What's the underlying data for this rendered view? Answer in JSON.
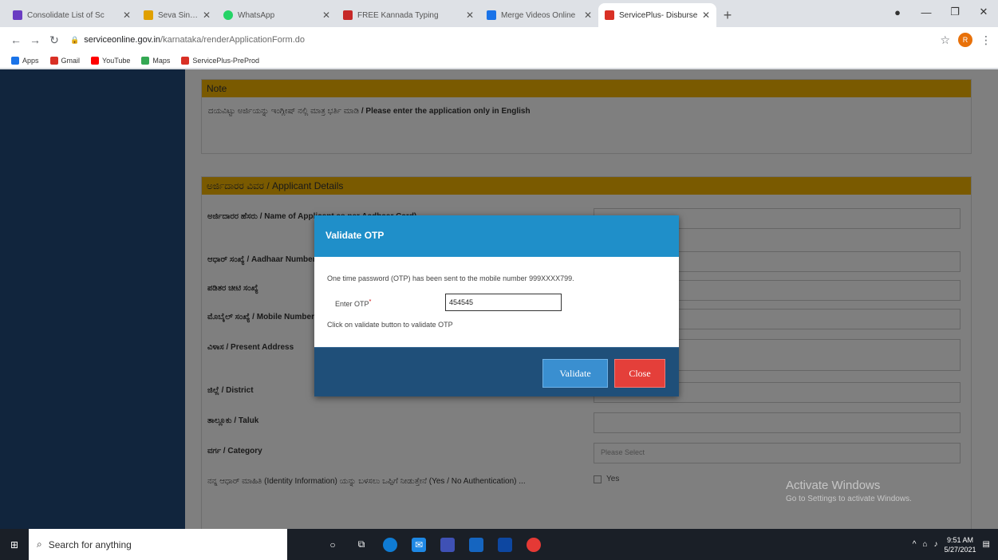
{
  "browser": {
    "tabs": [
      {
        "label": "Consolidate List of Sc",
        "icon_color": "#6a3cc2"
      },
      {
        "label": "Seva Sindhu",
        "icon_color": "#e0a000"
      },
      {
        "label": "WhatsApp",
        "icon_color": "#25d366"
      },
      {
        "label": "FREE Kannada Typing",
        "icon_color": "#c62828"
      },
      {
        "label": "Merge Videos Online",
        "icon_color": "#1a73e8"
      },
      {
        "label": "ServicePlus- Disburse",
        "icon_color": "#d93025",
        "active": true
      }
    ],
    "new_tab": "+",
    "url_host": "serviceonline.gov.in",
    "url_path": "/karnataka/renderApplicationForm.do",
    "profile_initial": "R"
  },
  "bookmarks": [
    {
      "label": "Apps",
      "color": "#1a73e8"
    },
    {
      "label": "Gmail",
      "color": "#d93025"
    },
    {
      "label": "YouTube",
      "color": "#ff0000"
    },
    {
      "label": "Maps",
      "color": "#34a853"
    },
    {
      "label": "ServicePlus-PreProd",
      "color": "#d93025"
    }
  ],
  "form": {
    "note_title": "Note",
    "note_text_kn": "ದಯವಿಟ್ಟು ಅರ್ಜಿಯನ್ನು ಇಂಗ್ಲೀಷ್ ನಲ್ಲಿ ಮಾತ್ರ ಭರ್ತಿ ಮಾಡಿ",
    "note_text_en": "/ Please enter the application only in English",
    "section_title": "ಅರ್ಜಿದಾರರ ವಿವರ / Applicant Details",
    "fields": [
      {
        "label": "ಅರ್ಜಿದಾರರ ಹೆಸರು / Name of Applicant as per Aadhaar Card)"
      },
      {
        "label": "ಆಧಾರ್ ಸಂಖ್ಯೆ / Aadhaar Number"
      },
      {
        "label": "ಪಡಿತರ ಚೀಟಿ ಸಂಖ್ಯೆ"
      },
      {
        "label": "ಮೊಬೈಲ್ ಸಂಖ್ಯೆ / Mobile Number"
      },
      {
        "label": "ವಿಳಾಸ / Present Address"
      },
      {
        "label": "ಜಿಲ್ಲೆ / District"
      },
      {
        "label": "ತಾಲ್ಲೂಕು / Taluk"
      },
      {
        "label": "ವರ್ಗ / Category",
        "placeholder": "Please Select"
      },
      {
        "label": "ನನ್ನ ಆಧಾರ್ ಮಾಹಿತಿ (Identity Information) ಯನ್ನು ಬಳಸಲು ಒಪ್ಪಿಗೆ ನೀಡುತ್ತೇನೆ (Yes / No Authentication) ...",
        "option": "Yes"
      }
    ]
  },
  "modal": {
    "title": "Validate OTP",
    "message": "One time password (OTP) has been sent to the mobile number 999XXXX799.",
    "otp_label": "Enter OTP",
    "otp_required": "*",
    "otp_value": "454545",
    "note": "Click on validate button to validate OTP",
    "validate_label": "Validate",
    "close_label": "Close"
  },
  "watermark": {
    "title": "Activate Windows",
    "subtitle": "Go to Settings to activate Windows."
  },
  "taskbar": {
    "search_placeholder": "Search for anything",
    "time": "9:51 AM",
    "date": "5/27/2021"
  }
}
